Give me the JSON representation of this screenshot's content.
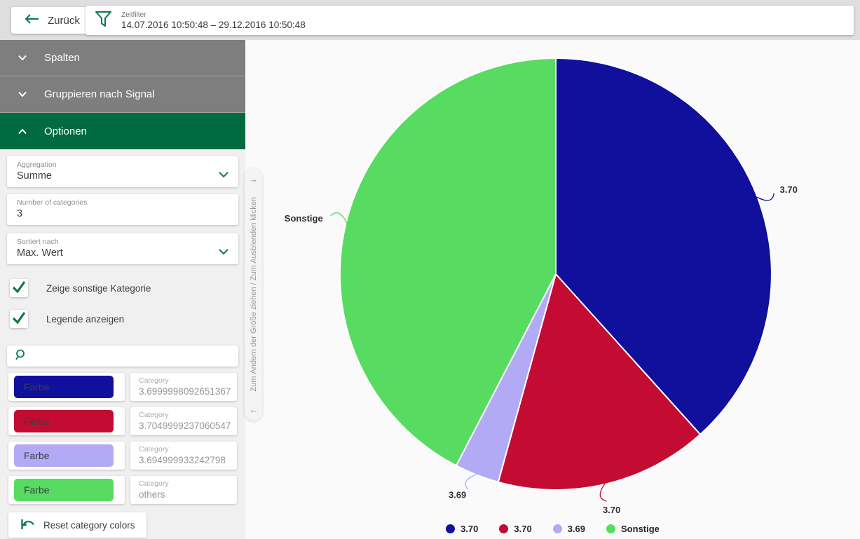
{
  "topbar": {
    "back_label": "Zurück",
    "zeitfilter": {
      "label": "Zeitfilter",
      "value": "14.07.2016 10:50:48 – 29.12.2016 10:50:48"
    }
  },
  "sidebar": {
    "sections": [
      {
        "label": "Spalten",
        "expanded": false
      },
      {
        "label": "Gruppieren nach Signal",
        "expanded": false
      },
      {
        "label": "Optionen",
        "expanded": true
      }
    ],
    "fields": {
      "aggregation": {
        "label": "Aggregation",
        "value": "Summe",
        "dropdown": true
      },
      "num_categories": {
        "label": "Number of categories",
        "value": "3"
      },
      "sorted_by": {
        "label": "Sortiert nach",
        "value": "Max. Wert",
        "dropdown": true
      }
    },
    "checkboxes": [
      {
        "label": "Zeige sonstige Kategorie",
        "checked": true
      },
      {
        "label": "Legende anzeigen",
        "checked": true
      }
    ],
    "search": {
      "placeholder": ""
    },
    "color_rows": [
      {
        "button_label": "Farbe",
        "color": "#10109c",
        "category_label": "Category",
        "category_value": "3.6999998092651367"
      },
      {
        "button_label": "Farbe",
        "color": "#c40b32",
        "category_label": "Category",
        "category_value": "3.7049999237060547"
      },
      {
        "button_label": "Farbe",
        "color": "#b3aaf6",
        "category_label": "Category",
        "category_value": "3.694999933242798"
      },
      {
        "button_label": "Farbe",
        "color": "#58db61",
        "category_label": "Category",
        "category_value": "others"
      }
    ],
    "reset_button_label": "Reset category colors"
  },
  "divider": {
    "tooltip": "Zum Ändern der Größe ziehen / Zum Ausblenden klicken",
    "arrow_top": "→",
    "arrow_bottom": "←"
  },
  "chart_data": {
    "type": "pie",
    "title": "",
    "direction": "clockwise",
    "start_angle_deg": 0,
    "slices": [
      {
        "label": "3.70",
        "color": "#10109c",
        "fraction": 0.3833
      },
      {
        "label": "3.70",
        "color": "#c40b32",
        "fraction": 0.1597
      },
      {
        "label": "3.69",
        "color": "#b3aaf6",
        "fraction": 0.0333
      },
      {
        "label": "Sonstige",
        "color": "#58db61",
        "fraction": 0.4237
      }
    ],
    "legend": {
      "position": "bottom",
      "items": [
        "3.70",
        "3.70",
        "3.69",
        "Sonstige"
      ]
    }
  },
  "colors": {
    "accent_green": "#006b40",
    "icon_green": "#0e7a4a",
    "header_gray": "#7e7e7e",
    "topbar_bg": "#dedede",
    "sidebar_bg": "#f0f0f0"
  }
}
